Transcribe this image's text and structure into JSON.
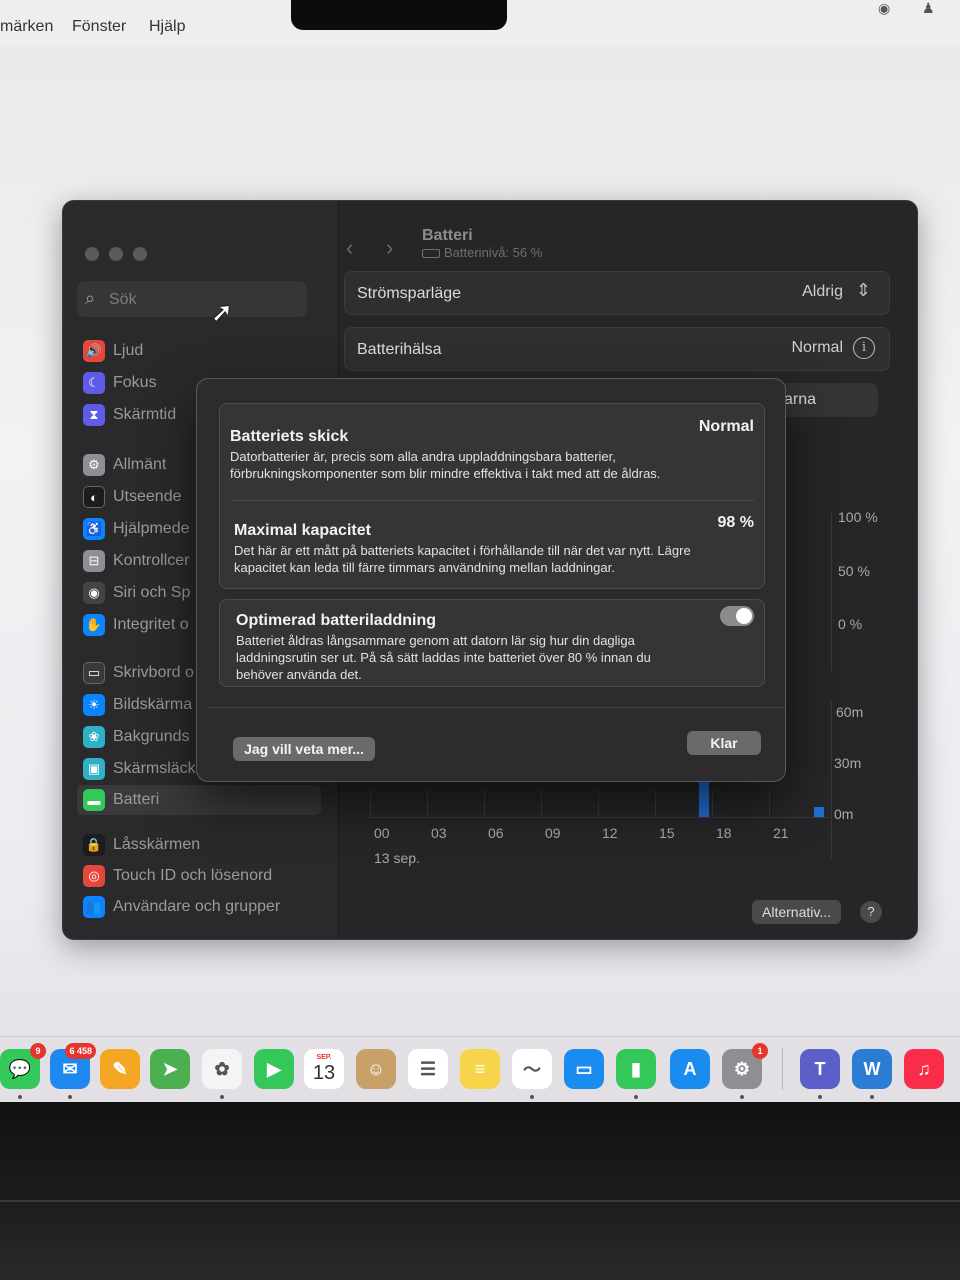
{
  "menubar": {
    "items": [
      "märken",
      "Fönster",
      "Hjälp"
    ]
  },
  "window": {
    "search_placeholder": "Sök",
    "sidebar": {
      "items": [
        {
          "label": "Ljud",
          "icon": "speaker-icon",
          "color": "#e5483b"
        },
        {
          "label": "Fokus",
          "icon": "moon-icon",
          "color": "#5e5ce6"
        },
        {
          "label": "Skärmtid",
          "icon": "hourglass-icon",
          "color": "#5e5ce6"
        },
        {
          "label": "Allmänt",
          "icon": "gear-icon",
          "color": "#8e8e93"
        },
        {
          "label": "Utseende",
          "icon": "appearance-icon",
          "color": "#1c1c1e"
        },
        {
          "label": "Hjälpmede",
          "icon": "accessibility-icon",
          "color": "#0a84ff"
        },
        {
          "label": "Kontrollcer",
          "icon": "control-center-icon",
          "color": "#8e8e93"
        },
        {
          "label": "Siri och Sp",
          "icon": "siri-icon",
          "color": "#444"
        },
        {
          "label": "Integritet o",
          "icon": "hand-icon",
          "color": "#0a84ff"
        },
        {
          "label": "Skrivbord o",
          "icon": "desktop-icon",
          "color": "#3a3a3c"
        },
        {
          "label": "Bildskärma",
          "icon": "brightness-icon",
          "color": "#0a84ff"
        },
        {
          "label": "Bakgrunds",
          "icon": "wallpaper-icon",
          "color": "#30b0c7"
        },
        {
          "label": "Skärmsläck",
          "icon": "screensaver-icon",
          "color": "#30b0c7"
        },
        {
          "label": "Batteri",
          "icon": "battery-icon",
          "color": "#34c759"
        },
        {
          "label": "Låsskärmen",
          "icon": "lock-icon",
          "color": "#1c1c1e"
        },
        {
          "label": "Touch ID och lösenord",
          "icon": "fingerprint-icon",
          "color": "#e5483b"
        },
        {
          "label": "Användare och grupper",
          "icon": "users-icon",
          "color": "#0a84ff"
        }
      ]
    },
    "header": {
      "title": "Batteri",
      "subtitle": "Batterinivå: 56 %"
    },
    "rows": {
      "power_saving": {
        "label": "Strömsparläge",
        "value": "Aldrig"
      },
      "battery_health": {
        "label": "Batterihälsa",
        "value": "Normal"
      },
      "partial_label": "arna"
    },
    "chart": {
      "level_ticks": [
        "100 %",
        "50 %",
        "0 %"
      ],
      "usage_ticks": [
        "60m",
        "30m",
        "0m"
      ],
      "hours": [
        "00",
        "03",
        "06",
        "09",
        "12",
        "15",
        "18",
        "21"
      ],
      "date": "13 sep."
    },
    "footer": {
      "options_label": "Alternativ...",
      "help_label": "?"
    }
  },
  "sheet": {
    "condition": {
      "title": "Batteriets skick",
      "value": "Normal",
      "text": "Datorbatterier är, precis som alla andra uppladdningsbara batterier, förbrukningskomponenter som blir mindre effektiva i takt med att de åldras."
    },
    "capacity": {
      "title": "Maximal kapacitet",
      "value": "98 %",
      "text": "Det här är ett mått på batteriets kapacitet i förhållande till när det var nytt. Lägre kapacitet kan leda till färre timmars användning mellan laddningar."
    },
    "optimized": {
      "title": "Optimerad batteriladdning",
      "text": "Batteriet åldras långsammare genom att datorn lär sig hur din dagliga laddningsrutin ser ut. På så sätt laddas inte batteriet över 80 % innan du behöver använda det.",
      "enabled": true
    },
    "learn_more_label": "Jag vill veta mer...",
    "done_label": "Klar"
  },
  "dock": {
    "apps": [
      {
        "name": "messages-icon",
        "color": "#34c759",
        "glyph": "💬",
        "badge": "9"
      },
      {
        "name": "mail-icon",
        "color": "#1e88f0",
        "glyph": "✉",
        "badge": "6 458"
      },
      {
        "name": "pages-icon",
        "color": "#f5a623",
        "glyph": "✎",
        "badge": ""
      },
      {
        "name": "maps-icon",
        "color": "#4cb050",
        "glyph": "➤",
        "badge": ""
      },
      {
        "name": "photos-icon",
        "color": "#f4f4f4",
        "glyph": "✿",
        "badge": ""
      },
      {
        "name": "facetime-icon",
        "color": "#34c759",
        "glyph": "▶",
        "badge": ""
      },
      {
        "name": "calendar-icon",
        "color": "#ffffff",
        "glyph": "13",
        "badge": ""
      },
      {
        "name": "contacts-icon",
        "color": "#c8a06a",
        "glyph": "☺",
        "badge": ""
      },
      {
        "name": "reminders-icon",
        "color": "#ffffff",
        "glyph": "☰",
        "badge": ""
      },
      {
        "name": "notes-icon",
        "color": "#f7d54a",
        "glyph": "≡",
        "badge": ""
      },
      {
        "name": "freeform-icon",
        "color": "#ffffff",
        "glyph": "〜",
        "badge": ""
      },
      {
        "name": "keynote-icon",
        "color": "#1a8cf0",
        "glyph": "▭",
        "badge": ""
      },
      {
        "name": "numbers-icon",
        "color": "#34c759",
        "glyph": "▮",
        "badge": ""
      },
      {
        "name": "app-store-icon",
        "color": "#1a8cf0",
        "glyph": "A",
        "badge": ""
      },
      {
        "name": "system-settings-icon",
        "color": "#8e8e93",
        "glyph": "⚙",
        "badge": "1"
      },
      {
        "name": "teams-icon",
        "color": "#5b5fc7",
        "glyph": "T",
        "badge": ""
      },
      {
        "name": "word-icon",
        "color": "#2b7cd3",
        "glyph": "W",
        "badge": ""
      },
      {
        "name": "music-icon",
        "color": "#fa2d48",
        "glyph": "♫",
        "badge": ""
      }
    ],
    "calendar_month": "SEP."
  }
}
